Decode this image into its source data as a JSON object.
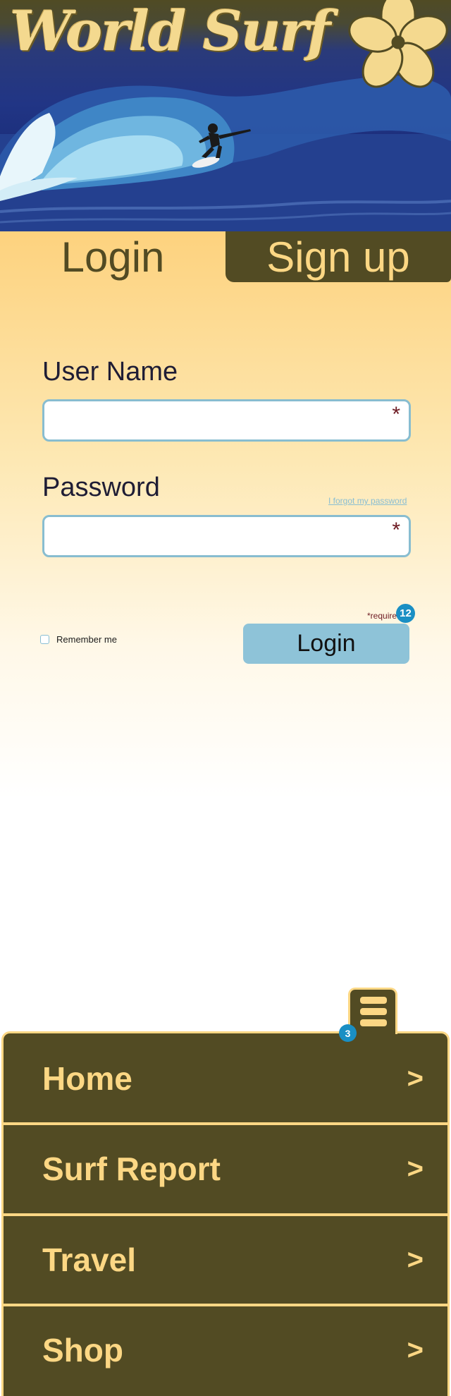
{
  "header": {
    "logo_text": "World Surf",
    "logo_icon": "hibiscus-flower-icon"
  },
  "tabs": [
    {
      "label": "Login",
      "active": true
    },
    {
      "label": "Sign up",
      "active": false
    }
  ],
  "form": {
    "username_label": "User Name",
    "username_value": "",
    "username_required_mark": "*",
    "password_label": "Password",
    "password_value": "",
    "password_required_mark": "*",
    "forgot_link": "I forgot my password",
    "required_note": "*required",
    "remember_label": "Remember me",
    "remember_checked": false,
    "submit_label": "Login"
  },
  "badges": {
    "login_badge": "12",
    "menu_badge": "3"
  },
  "menu": {
    "toggle_icon": "hamburger-menu-icon",
    "items": [
      {
        "label": "Home",
        "chevron": ">"
      },
      {
        "label": "Surf Report",
        "chevron": ">"
      },
      {
        "label": "Travel",
        "chevron": ">"
      },
      {
        "label": "Shop",
        "chevron": ">"
      }
    ]
  },
  "colors": {
    "olive": "#524b23",
    "gold": "#fcd784",
    "button_blue": "#8ec3d8",
    "badge_blue": "#1a8fc4",
    "required_red": "#6d1a22"
  }
}
